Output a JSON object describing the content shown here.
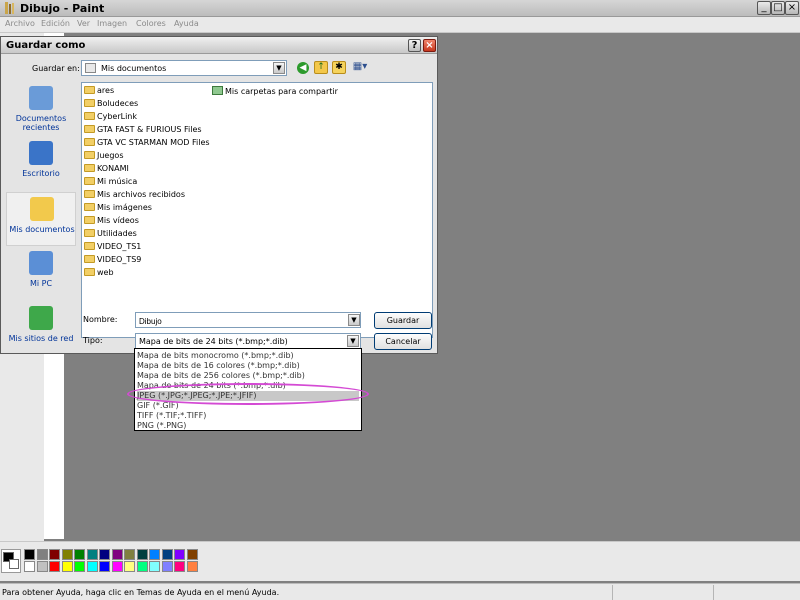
{
  "window": {
    "title": "Dibujo - Paint",
    "menu": [
      "Archivo",
      "Edición",
      "Ver",
      "Imagen",
      "Colores",
      "Ayuda"
    ],
    "controls": {
      "minimize": "_",
      "maximize": "□",
      "close": "×"
    }
  },
  "dialog": {
    "title": "Guardar como",
    "help_glyph": "?",
    "close_glyph": "×",
    "save_in_label": "Guardar en:",
    "save_in_value": "Mis documentos",
    "nav": {
      "back_glyph": "◀",
      "up_glyph": "↑",
      "new_folder_glyph": "✱",
      "views_glyph": "▦▾"
    },
    "places": [
      {
        "label": "Documentos recientes",
        "icon": "recent-documents-icon",
        "color": "#6a9bd8"
      },
      {
        "label": "Escritorio",
        "icon": "desktop-icon",
        "color": "#3a74c8"
      },
      {
        "label": "Mis documentos",
        "icon": "my-documents-icon",
        "color": "#f2c94c"
      },
      {
        "label": "Mi PC",
        "icon": "my-computer-icon",
        "color": "#5b8fd6"
      },
      {
        "label": "Mis sitios de red",
        "icon": "network-places-icon",
        "color": "#3ea84a"
      }
    ],
    "files": [
      "ares",
      "Boludeces",
      "CyberLink",
      "GTA FAST & FURIOUS Files",
      "GTA VC STARMAN MOD Files",
      "Juegos",
      "KONAMI",
      "Mi música",
      "Mis archivos recibidos",
      "Mis imágenes",
      "Mis vídeos",
      "Utilidades",
      "VIDEO_TS1",
      "VIDEO_TS9",
      "web"
    ],
    "shared_folder": "Mis carpetas para compartir",
    "name_label": "Nombre:",
    "name_value": "Dibujo",
    "type_label": "Tipo:",
    "type_value": "Mapa de bits de 24 bits (*.bmp;*.dib)",
    "save_button": "Guardar",
    "cancel_button": "Cancelar",
    "type_options": [
      "Mapa de bits monocromo (*.bmp;*.dib)",
      "Mapa de bits de 16 colores (*.bmp;*.dib)",
      "Mapa de bits de 256 colores (*.bmp;*.dib)",
      "Mapa de bits de 24 bits (*.bmp;*.dib)",
      "JPEG (*.JPG;*.JPEG;*.JPE;*.JFIF)",
      "GIF (*.GIF)",
      "TIFF (*.TIF;*.TIFF)",
      "PNG (*.PNG)"
    ],
    "selected_type_index": 4,
    "highlight_color": "#d44ad4"
  },
  "palette": {
    "top": [
      "#000000",
      "#808080",
      "#800000",
      "#808000",
      "#008000",
      "#008080",
      "#000080",
      "#800080",
      "#808040",
      "#004040",
      "#0080ff",
      "#004080",
      "#8000ff",
      "#804000"
    ],
    "bottom": [
      "#ffffff",
      "#c0c0c0",
      "#ff0000",
      "#ffff00",
      "#00ff00",
      "#00ffff",
      "#0000ff",
      "#ff00ff",
      "#ffff80",
      "#00ff80",
      "#80ffff",
      "#8080ff",
      "#ff0080",
      "#ff8040"
    ]
  },
  "status": {
    "text": "Para obtener Ayuda, haga clic en Temas de Ayuda en el menú Ayuda."
  }
}
